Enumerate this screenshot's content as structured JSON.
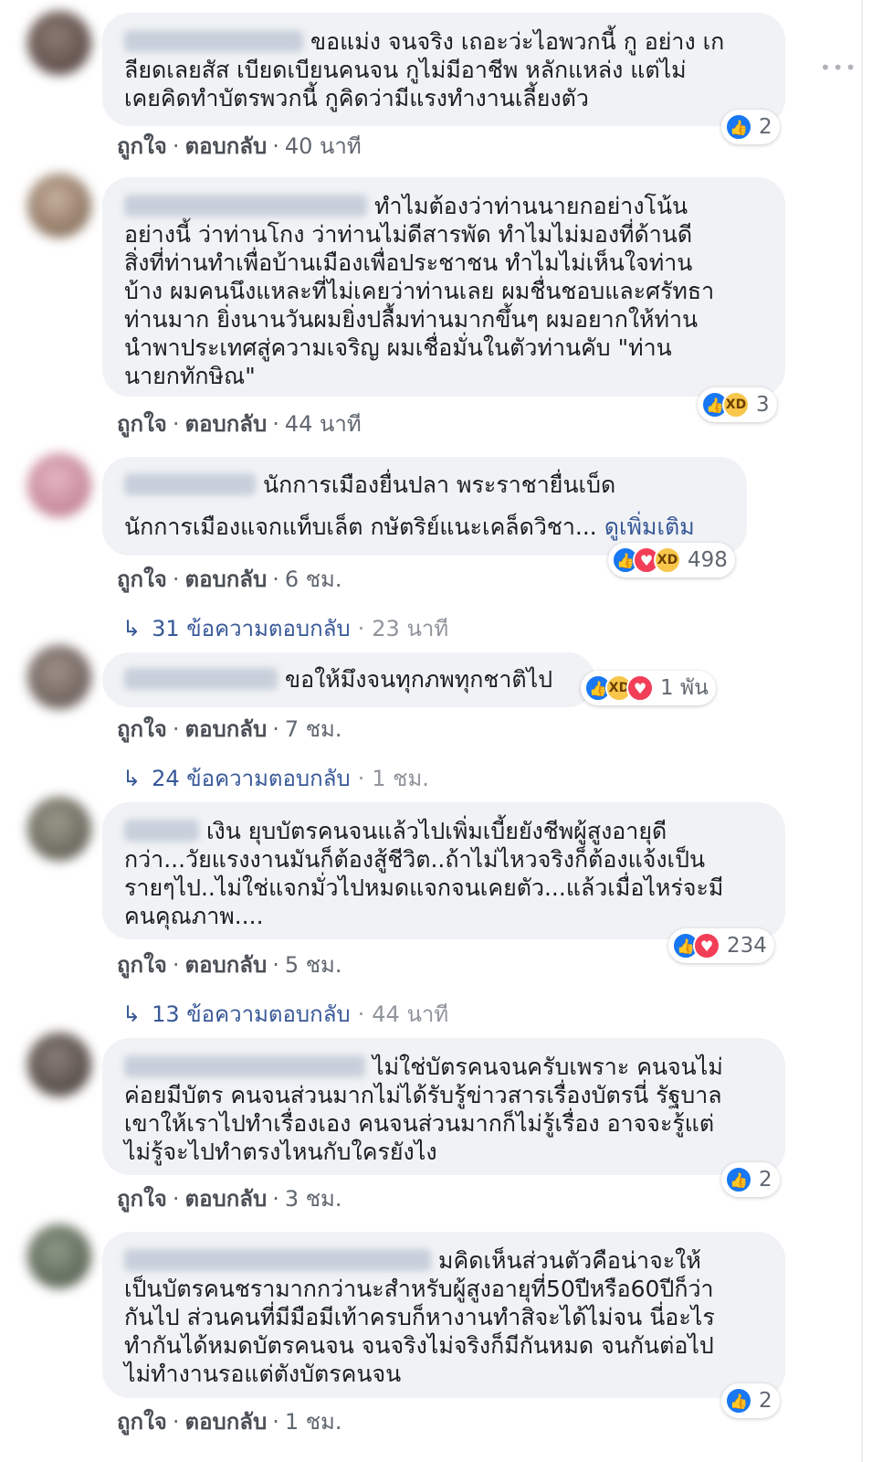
{
  "labels": {
    "like": "ถูกใจ",
    "reply": "ตอบกลับ",
    "separator": "·",
    "see_more": "ดูเพิ่มเติม"
  },
  "comments": [
    {
      "lines": [
        "ขอแม่ง จนจริง เถอะว่ะไอพวกนี้ กู อย่าง เก",
        "ลียดเลยสัส เบียดเบียนคนจน กูไม่มีอาชีพ หลักแหล่ง แต่ไม่",
        "เคยคิดทำบัตรพวกนี้ กูคิดว่ามีแรงทำงานเลี้ยงตัว"
      ],
      "reaction_icons": [
        "like-icon"
      ],
      "reaction_count": "2",
      "time": "40 นาที"
    },
    {
      "lines": [
        "ทำไมต้องว่าท่านนายกอย่างโน้น",
        "อย่างนี้ ว่าท่านโกง ว่าท่านไม่ดีสารพัด ทำไมไม่มองที่ด้านดี",
        "สิ่งที่ท่านทำเพื่อบ้านเมืองเพื่อประชาชน ทำไมไม่เห็นใจท่าน",
        "บ้าง ผมคนนึงแหละที่ไม่เคยว่าท่านเลย ผมชื่นชอบและศรัทธา",
        "ท่านมาก ยิ่งนานวันผมยิ่งปลื้มท่านมากขึ้นๆ ผมอยากให้ท่าน",
        "นำพาประเทศสู่ความเจริญ ผมเชื่อมั่นในตัวท่านคับ \"ท่าน",
        "นายกทักษิณ\""
      ],
      "reaction_icons": [
        "like-icon",
        "haha-icon"
      ],
      "reaction_count": "3",
      "time": "44 นาที"
    },
    {
      "lines": [
        "นักการเมืองยื่นปลา พระราชายื่นเบ็ด",
        "นักการเมืองแจกแท็บเล็ต กษัตริย์แนะเคล็ดวิชา..."
      ],
      "reaction_icons": [
        "like-icon",
        "love-icon",
        "haha-icon"
      ],
      "reaction_count": "498",
      "time": "6 ชม.",
      "replies": {
        "text": "31 ข้อความตอบกลับ",
        "time": "23 นาที"
      }
    },
    {
      "lines": [
        "ขอให้มึงจนทุกภพทุกชาติไป"
      ],
      "reaction_icons": [
        "like-icon",
        "haha-icon",
        "love-icon"
      ],
      "reaction_count": "1 พัน",
      "time": "7 ชม.",
      "replies": {
        "text": "24 ข้อความตอบกลับ",
        "time": "1 ชม."
      }
    },
    {
      "lines": [
        "เงิน ยุบบัตรคนจนแล้วไปเพิ่มเบี้ยยังชีพผู้สูงอายุดี",
        "กว่า...วัยแรงงานมันก็ต้องสู้ชีวิต..ถ้าไม่ไหวจริงก็ต้องแจ้งเป็น",
        "รายๆไป..ไม่ใช่แจกมั่วไปหมดแจกจนเคยตัว...แล้วเมื่อไหร่จะมี",
        "คนคุณภาพ...."
      ],
      "reaction_icons": [
        "like-icon",
        "love-icon"
      ],
      "reaction_count": "234",
      "time": "5 ชม.",
      "replies": {
        "text": "13 ข้อความตอบกลับ",
        "time": "44 นาที"
      }
    },
    {
      "lines": [
        "ไม่ใช่บัตรคนจนครับเพราะ คนจนไม่",
        "ค่อยมีบัตร คนจนส่วนมากไม่ได้รับรู้ข่าวสารเรื่องบัตรนี่ รัฐบาล",
        "เขาให้เราไปทำเรื่องเอง คนจนส่วนมากก็ไม่รู้เรื่อง อาจจะรู้แต่",
        "ไม่รู้จะไปทำตรงไหนกับใครยังไง"
      ],
      "reaction_icons": [
        "like-icon"
      ],
      "reaction_count": "2",
      "time": "3 ชม."
    },
    {
      "lines": [
        "มคิดเห็นส่วนตัวคือน่าจะให้",
        "เป็นบัตรคนชรามากกว่านะสำหรับผู้สูงอายุที่50ปีหรือ60ปีก็ว่า",
        "กันไป ส่วนคนที่มีมือมีเท้าครบก็หางานทำสิจะได้ไม่จน นี่อะไร",
        "ทำกันได้หมดบัตรคนจน จนจริงไม่จริงก็มีกันหมด จนกันต่อไป",
        "ไม่ทำงานรอแต่ตังบัตรคนจน"
      ],
      "reaction_icons": [
        "like-icon"
      ],
      "reaction_count": "2",
      "time": "1 ชม."
    }
  ]
}
